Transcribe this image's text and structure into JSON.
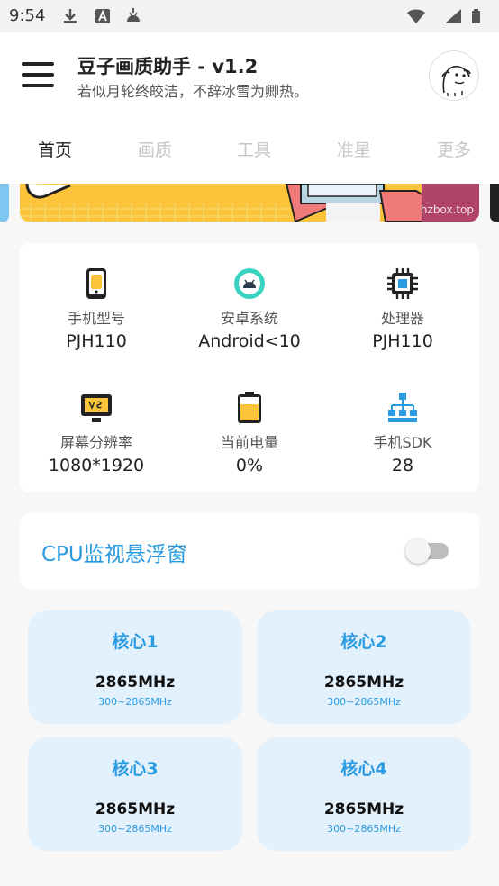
{
  "status_bar": {
    "time": "9:54",
    "left_icons": [
      "download-icon",
      "font-a-icon",
      "android-icon"
    ],
    "right_icons": [
      "wifi-icon",
      "signal-icon",
      "battery-icon"
    ]
  },
  "header": {
    "title": "豆子画质助手 - v1.2",
    "subtitle": "若似月轮终皎洁，不辞冰雪为卿热。"
  },
  "tabs": [
    {
      "label": "首页",
      "active": true
    },
    {
      "label": "画质",
      "active": false
    },
    {
      "label": "工具",
      "active": false
    },
    {
      "label": "准星",
      "active": false
    },
    {
      "label": "更多",
      "active": false
    }
  ],
  "banner": {
    "watermark": "hzbox.top"
  },
  "device_info": [
    {
      "icon": "phone-icon",
      "label": "手机型号",
      "value": "PJH110"
    },
    {
      "icon": "android-system-icon",
      "label": "安卓系统",
      "value": "Android<10"
    },
    {
      "icon": "processor-icon",
      "label": "处理器",
      "value": "PJH110"
    },
    {
      "icon": "screen-icon",
      "label": "屏幕分辨率",
      "value": "1080*1920"
    },
    {
      "icon": "battery-level-icon",
      "label": "当前电量",
      "value": "0%"
    },
    {
      "icon": "sdk-icon",
      "label": "手机SDK",
      "value": "28"
    }
  ],
  "cpu_monitor": {
    "label": "CPU监视悬浮窗",
    "enabled": false
  },
  "cores": [
    {
      "name": "核心1",
      "freq": "2865MHz",
      "range": "300~2865MHz"
    },
    {
      "name": "核心2",
      "freq": "2865MHz",
      "range": "300~2865MHz"
    },
    {
      "name": "核心3",
      "freq": "2865MHz",
      "range": "300~2865MHz"
    },
    {
      "name": "核心4",
      "freq": "2865MHz",
      "range": "300~2865MHz"
    }
  ],
  "colors": {
    "accent": "#2a9be0",
    "banner": "#fcc43a",
    "core_bg": "#e3f1fc"
  }
}
